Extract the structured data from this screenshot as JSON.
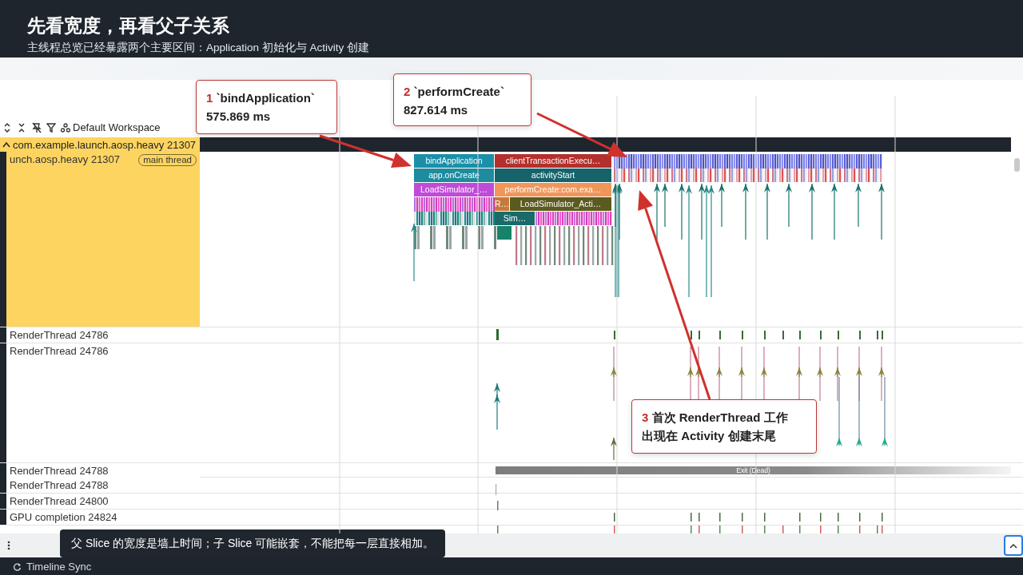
{
  "header": {
    "title": "先看宽度，再看父子关系",
    "subtitle": "主线程总览已经暴露两个主要区间：Application 初始化与 Activity 创建"
  },
  "toolbar": {
    "workspace": "Default Workspace"
  },
  "process": {
    "label": "com.example.launch.aosp.heavy 21307",
    "expanded": true,
    "selected": true
  },
  "tracks": [
    {
      "name": "unch.aosp.heavy 21307",
      "badge": "main thread",
      "kind": "main",
      "selected": true
    },
    {
      "name": "RenderThread 24786",
      "kind": "thin",
      "selected": false
    },
    {
      "name": "RenderThread 24786",
      "kind": "tall",
      "selected": false
    },
    {
      "name": "RenderThread 24788",
      "kind": "state",
      "state": "Exit (Dead)",
      "selected": false
    },
    {
      "name": "RenderThread 24788",
      "kind": "thin",
      "selected": false
    },
    {
      "name": "RenderThread 24800",
      "kind": "thin",
      "selected": false
    },
    {
      "name": "GPU completion 24824",
      "kind": "thin",
      "selected": false
    }
  ],
  "slices": [
    {
      "name": "bindApplication",
      "color": "#1b8fa8"
    },
    {
      "name": "clientTransactionExecu…",
      "color": "#b3302c"
    },
    {
      "name": "app.onCreate",
      "color": "#1e8b9e"
    },
    {
      "name": "activityStart",
      "color": "#17636c"
    },
    {
      "name": "LoadSimulator_…",
      "color": "#c04bd8"
    },
    {
      "name": "performCreate:com.exa…",
      "color": "#f0965a"
    },
    {
      "name": "R…",
      "color": "#c8793a"
    },
    {
      "name": "LoadSimulator_Acti…",
      "color": "#5b5a1f"
    },
    {
      "name": "Sim…",
      "color": "#1a6a6a"
    }
  ],
  "callouts": [
    {
      "number": "1",
      "lines": [
        "`bindApplication`",
        "575.869 ms"
      ]
    },
    {
      "number": "2",
      "lines": [
        "`performCreate`",
        "827.614 ms"
      ]
    },
    {
      "number": "3",
      "lines": [
        "首次 RenderThread 工作",
        "出现在 Activity 创建末尾"
      ]
    }
  ],
  "caption": "父 Slice 的宽度是墙上时间；子 Slice 可能嵌套，不能把每一层直接相加。",
  "status_bar": {
    "label": "Timeline Sync"
  }
}
